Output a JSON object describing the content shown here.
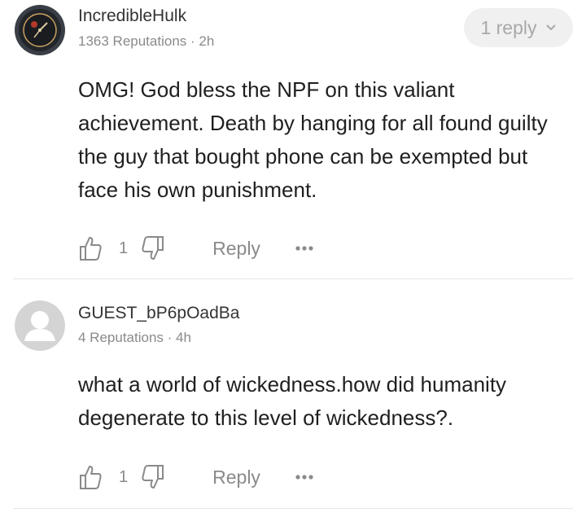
{
  "comments": [
    {
      "username": "IncredibleHulk",
      "reputation": "1363 Reputations",
      "time": "2h",
      "text": "OMG! God bless the NPF on this valiant achievement. Death by hanging for all found guilty the guy that bought phone can be exempted but face his own punishment.",
      "replies_label": "1 reply",
      "likes": "1",
      "reply_label": "Reply"
    },
    {
      "username": "GUEST_bP6pOadBa",
      "reputation": "4 Reputations",
      "time": "4h",
      "text": "what a world of wickedness.how did humanity degenerate to this level of wickedness?.",
      "likes": "1",
      "reply_label": "Reply"
    }
  ],
  "colors": {
    "muted": "#8a8a8a",
    "pill_bg": "#f0f0f0",
    "divider": "#e6e6e6"
  }
}
